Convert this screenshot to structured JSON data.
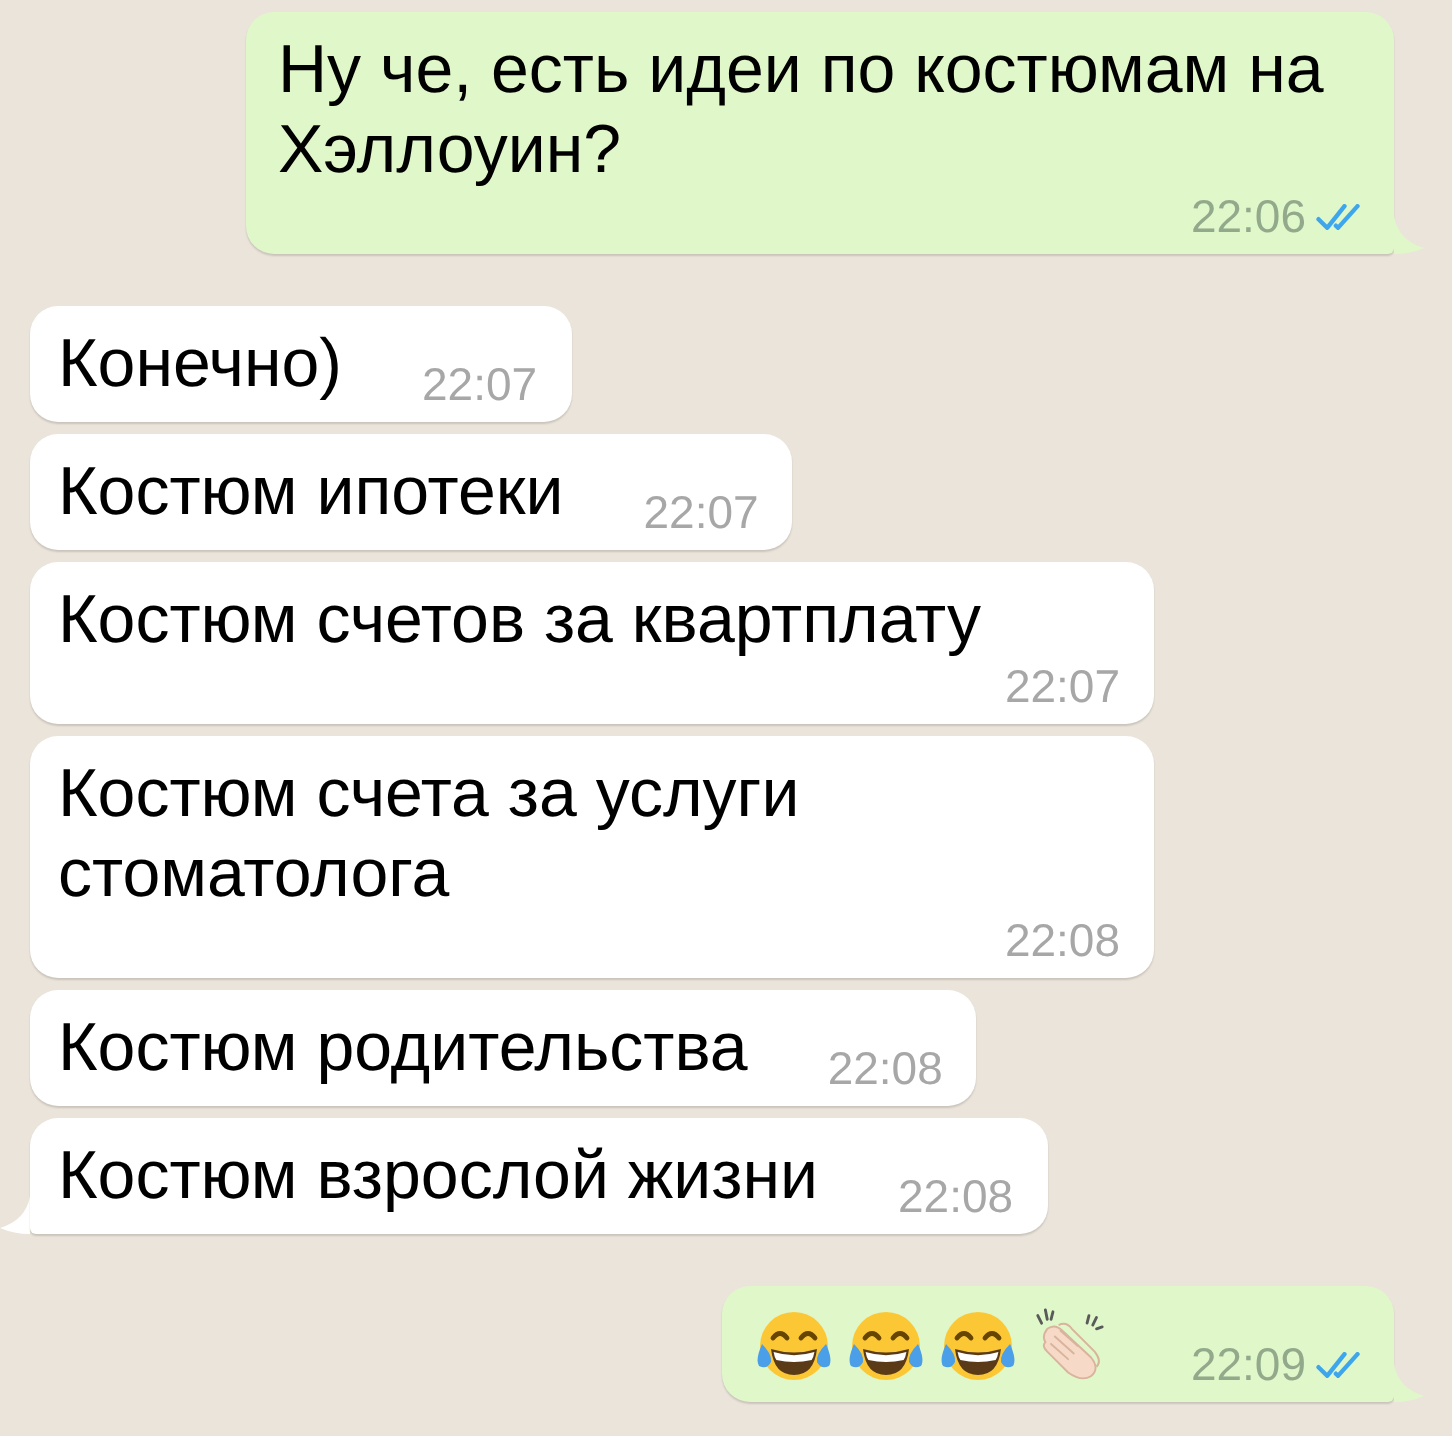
{
  "messages": [
    {
      "kind": "sent",
      "text": "Ну че, есть идеи по костюмам на Хэллоуин?",
      "time": "22:06",
      "read": true,
      "tail": true
    },
    {
      "kind": "received",
      "text": "Конечно)",
      "time": "22:07",
      "tail": false
    },
    {
      "kind": "received",
      "text": "Костюм ипотеки",
      "time": "22:07",
      "tail": false
    },
    {
      "kind": "received",
      "text": "Костюм счетов за квартплату",
      "time": "22:07",
      "tail": false
    },
    {
      "kind": "received",
      "text": "Костюм счета за услуги стоматолога",
      "time": "22:08",
      "tail": false
    },
    {
      "kind": "received",
      "text": "Костюм родительства",
      "time": "22:08",
      "tail": false
    },
    {
      "kind": "received",
      "text": "Костюм взрослой жизни",
      "time": "22:08",
      "tail": true
    },
    {
      "kind": "sent",
      "emojis": [
        {
          "kind": "tears_of_joy"
        },
        {
          "kind": "tears_of_joy"
        },
        {
          "kind": "tears_of_joy"
        },
        {
          "kind": "clapping_hands"
        }
      ],
      "time": "22:09",
      "read": true,
      "tail": true
    }
  ]
}
